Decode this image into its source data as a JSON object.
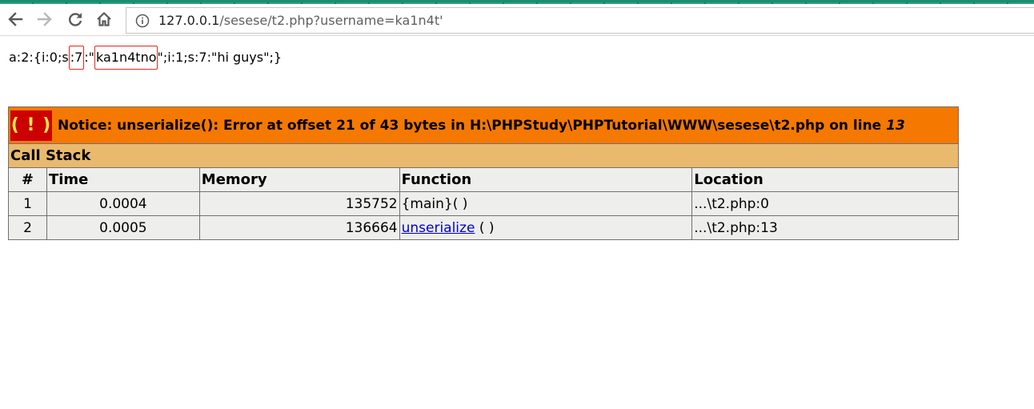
{
  "browser": {
    "url_host": "127.0.0.1",
    "url_path": "/sesese/t2.php?username=ka1n4t'"
  },
  "page": {
    "serialized_parts": {
      "before_len": "a:2:{i:0;s",
      "len_box": ":7",
      "between": ":\"",
      "value_box": "ka1n4tno",
      "after": "\";i:1;s:7:\"hi guys\";}"
    }
  },
  "xdebug": {
    "bang": "( ! )",
    "notice_text": "Notice: unserialize(): Error at offset 21 of 43 bytes in H:\\PHPStudy\\PHPTutorial\\WWW\\sesese\\t2.php on line ",
    "notice_line": "13",
    "call_stack_title": "Call Stack",
    "columns": [
      "#",
      "Time",
      "Memory",
      "Function",
      "Location"
    ],
    "rows": [
      {
        "num": "1",
        "time": "0.0004",
        "memory": "135752",
        "function": "{main}( )",
        "function_link": "",
        "function_suffix": "",
        "location": "...\\t2.php:0"
      },
      {
        "num": "2",
        "time": "0.0005",
        "memory": "136664",
        "function": "",
        "function_link": "unserialize",
        "function_suffix": " ( )",
        "location": "...\\t2.php:13"
      }
    ],
    "colors": {
      "notice_bg": "#f57900",
      "bang_bg": "#cc0000",
      "bang_fg": "#fce94f",
      "callstack_bg": "#e9b96e",
      "cell_bg": "#eeeeec",
      "link": "#0000cc",
      "annotation_box": "#e0291c"
    }
  },
  "icons": {
    "back": "arrow-left-icon",
    "forward": "arrow-right-icon",
    "reload": "reload-icon",
    "home": "home-icon",
    "info": "info-icon"
  }
}
